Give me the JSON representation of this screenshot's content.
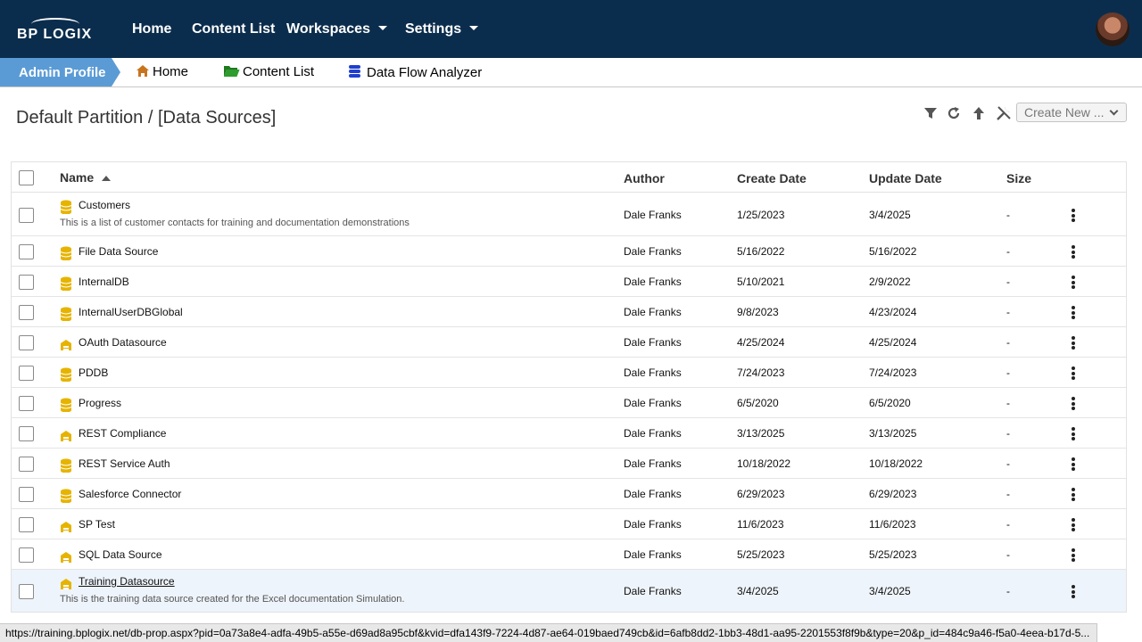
{
  "brand": {
    "logo_text": "BP LOGIX"
  },
  "topnav": {
    "home": "Home",
    "content_list": "Content List",
    "workspaces": "Workspaces",
    "settings": "Settings"
  },
  "tabs": {
    "admin_profile": "Admin Profile",
    "home": "Home",
    "content_list": "Content List",
    "data_flow_analyzer": "Data Flow Analyzer"
  },
  "page": {
    "title": "Default Partition / [Data Sources]"
  },
  "toolbar": {
    "create_new": "Create New ..."
  },
  "columns": {
    "name": "Name",
    "author": "Author",
    "create_date": "Create Date",
    "update_date": "Update Date",
    "size": "Size"
  },
  "rows": [
    {
      "name": "Customers",
      "description": "This is a list of customer contacts for training and documentation demonstrations",
      "author": "Dale Franks",
      "create_date": "1/25/2023",
      "update_date": "3/4/2025",
      "size": "-",
      "icon": "database-icon"
    },
    {
      "name": "File Data Source",
      "author": "Dale Franks",
      "create_date": "5/16/2022",
      "update_date": "5/16/2022",
      "size": "-",
      "icon": "database-icon"
    },
    {
      "name": "InternalDB",
      "author": "Dale Franks",
      "create_date": "5/10/2021",
      "update_date": "2/9/2022",
      "size": "-",
      "icon": "database-icon"
    },
    {
      "name": "InternalUserDBGlobal",
      "author": "Dale Franks",
      "create_date": "9/8/2023",
      "update_date": "4/23/2024",
      "size": "-",
      "icon": "database-icon"
    },
    {
      "name": "OAuth Datasource",
      "author": "Dale Franks",
      "create_date": "4/25/2024",
      "update_date": "4/25/2024",
      "size": "-",
      "icon": "warehouse-icon"
    },
    {
      "name": "PDDB",
      "author": "Dale Franks",
      "create_date": "7/24/2023",
      "update_date": "7/24/2023",
      "size": "-",
      "icon": "database-icon"
    },
    {
      "name": "Progress",
      "author": "Dale Franks",
      "create_date": "6/5/2020",
      "update_date": "6/5/2020",
      "size": "-",
      "icon": "database-icon"
    },
    {
      "name": "REST Compliance",
      "author": "Dale Franks",
      "create_date": "3/13/2025",
      "update_date": "3/13/2025",
      "size": "-",
      "icon": "warehouse-icon"
    },
    {
      "name": "REST Service Auth",
      "author": "Dale Franks",
      "create_date": "10/18/2022",
      "update_date": "10/18/2022",
      "size": "-",
      "icon": "database-icon"
    },
    {
      "name": "Salesforce Connector",
      "author": "Dale Franks",
      "create_date": "6/29/2023",
      "update_date": "6/29/2023",
      "size": "-",
      "icon": "database-icon"
    },
    {
      "name": "SP Test",
      "author": "Dale Franks",
      "create_date": "11/6/2023",
      "update_date": "11/6/2023",
      "size": "-",
      "icon": "warehouse-icon"
    },
    {
      "name": "SQL Data Source",
      "author": "Dale Franks",
      "create_date": "5/25/2023",
      "update_date": "5/25/2023",
      "size": "-",
      "icon": "warehouse-icon"
    },
    {
      "name": "Training Datasource",
      "description": "This is the training data source created for the Excel documentation Simulation.",
      "author": "Dale Franks",
      "create_date": "3/4/2025",
      "update_date": "3/4/2025",
      "size": "-",
      "icon": "warehouse-icon",
      "selected": true
    }
  ],
  "status_bar": {
    "url": "https://training.bplogix.net/db-prop.aspx?pid=0a73a8e4-adfa-49b5-a55e-d69ad8a95cbf&kvid=dfa143f9-7224-4d87-ae64-019baed749cb&id=6afb8dd2-1bb3-48d1-aa95-2201553f8f9b&type=20&p_id=484c9a46-f5a0-4eea-b17d-5..."
  },
  "colors": {
    "topbar": "#0b2d4d",
    "admin_tab": "#5b9bd5",
    "db_icon": "#e6b400",
    "home_icon": "#c8741e",
    "folder_icon": "#2e9c2e",
    "analyzer_icon": "#1f3fcf"
  }
}
